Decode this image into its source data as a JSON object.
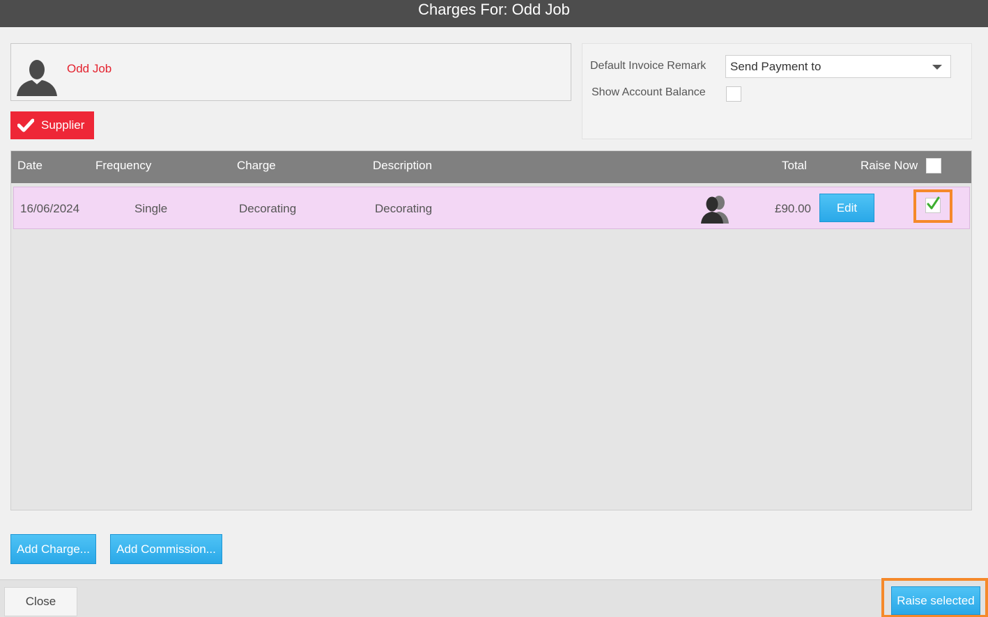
{
  "window": {
    "title": "Charges For: Odd Job"
  },
  "contact": {
    "name": "Odd Job",
    "avatar_icon": "person-silhouette-icon"
  },
  "badge": {
    "label": "Supplier",
    "icon": "checkmark-icon",
    "color": "#ee2737"
  },
  "options": {
    "invoice_remark_label": "Default Invoice Remark",
    "invoice_remark_value": "Send Payment to",
    "show_balance_label": "Show Account Balance",
    "show_balance_checked": false
  },
  "grid": {
    "columns": [
      "Date",
      "Frequency",
      "Charge",
      "Description",
      "Total",
      "Raise Now"
    ],
    "rows": [
      {
        "date": "16/06/2024",
        "frequency": "Single",
        "charge": "Decorating",
        "description": "Decorating",
        "total": "£90.00",
        "edit_label": "Edit",
        "raise_now_checked": true
      }
    ]
  },
  "actions": {
    "add_charge": "Add Charge...",
    "add_commission": "Add Commission..."
  },
  "footer": {
    "close": "Close",
    "raise_selected": "Raise selected"
  },
  "colors": {
    "accent_blue": "#2aa8e8",
    "highlight_orange": "#f5892a",
    "row_pink": "#f3d7f5"
  }
}
